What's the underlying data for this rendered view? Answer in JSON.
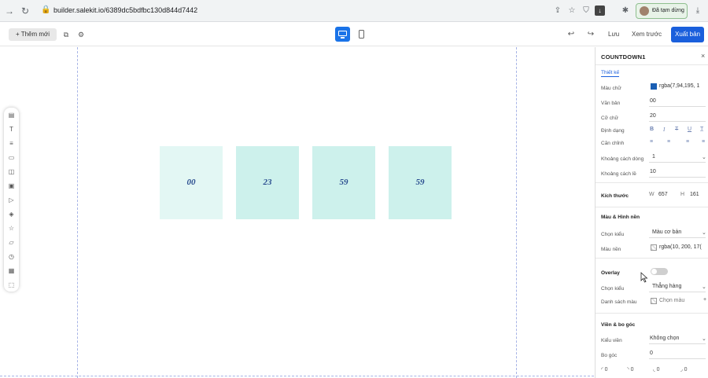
{
  "browser": {
    "url": "builder.salekit.io/6389dc5bdfbc130d844d7442",
    "paused_label": "Đã tạm dừng",
    "icons": [
      "back-icon",
      "reload-icon",
      "lock-icon",
      "share-icon",
      "star-icon",
      "shield-icon",
      "extension-download-icon",
      "puzzle-icon",
      "download-icon"
    ]
  },
  "toolbar": {
    "add_label": "+ Thêm mới",
    "save_label": "Lưu",
    "preview_label": "Xem trước",
    "publish_label": "Xuất bản",
    "icons": [
      "copy-icon",
      "settings-icon",
      "desktop-icon",
      "mobile-icon",
      "undo-icon",
      "redo-icon"
    ]
  },
  "left_tools": [
    "section-icon",
    "text-icon",
    "paragraph-icon",
    "form-icon",
    "image-icon",
    "gallery-icon",
    "video-icon",
    "shape-icon",
    "star-icon",
    "slideshow-icon",
    "countdown-icon",
    "popup-icon",
    "frame-icon"
  ],
  "countdown": {
    "values": [
      "00",
      "23",
      "59",
      "59"
    ],
    "colors": [
      "#e3f7f4",
      "#cdf1ec",
      "#cdf1ec",
      "#cdf1ec"
    ]
  },
  "panel": {
    "title": "COUNTDOWN1",
    "tab": "Thiết kế",
    "text_color_label": "Màu chữ",
    "text_color_value": "rgba(7,94,195, 1",
    "text_label": "Văn bản",
    "text_value": "00",
    "font_size_label": "Cỡ chữ",
    "font_size_value": "20",
    "format_label": "Định dạng",
    "align_label": "Căn chỉnh",
    "line_spacing_label": "Khoảng cách dòng",
    "line_spacing_value": "1",
    "letter_spacing_label": "Khoảng cách lề",
    "letter_spacing_value": "10",
    "size_label": "Kích thước",
    "width_label": "W",
    "width_value": "657",
    "height_label": "H",
    "height_value": "161",
    "bg_section": "Màu & Hình nền",
    "bg_type_label": "Chọn kiểu",
    "bg_type_value": "Màu cơ bản",
    "bg_color_label": "Màu nền",
    "bg_color_value": "rgba(10, 200, 17(",
    "overlay_section": "Overlay",
    "overlay_type_label": "Chọn kiểu",
    "overlay_type_value": "Thẳng hàng",
    "overlay_list_label": "Danh sách màu",
    "overlay_list_value": "Chọn màu",
    "border_section": "Viền & bo góc",
    "border_type_label": "Kiểu viền",
    "border_type_value": "Không chọn",
    "radius_label": "Bo góc",
    "radius_value": "0",
    "corners": [
      "0",
      "0",
      "0",
      "0"
    ],
    "accent": "#1a5fdc"
  }
}
